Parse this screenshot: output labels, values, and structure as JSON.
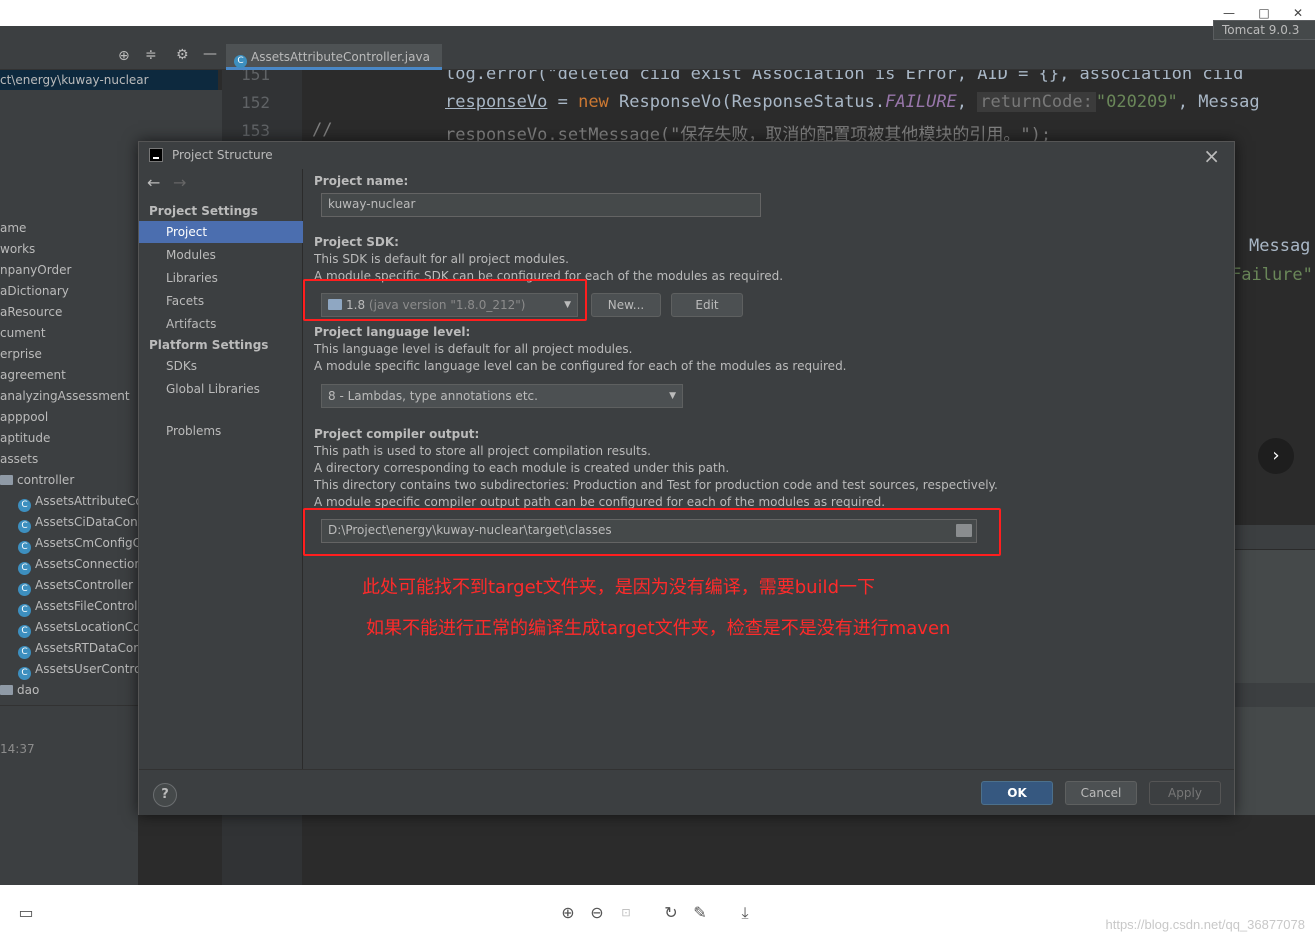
{
  "ide": {
    "path_fragment": "ct\\energy\\kuway-nuclear",
    "editor_tab": "AssetsAttributeController.java",
    "run_config": "Tomcat 9.0.3",
    "tree_items": [
      "ame",
      "works",
      "npanyOrder",
      "aDictionary",
      "aResource",
      "cument",
      "erprise",
      "agreement",
      "analyzingAssessment",
      "apppool",
      "aptitude",
      "assets"
    ],
    "tree_controller": "controller",
    "tree_classes": [
      "AssetsAttributeCo",
      "AssetsCiDataCont",
      "AssetsCmConfigC",
      "AssetsConnection",
      "AssetsController",
      "AssetsFileControll",
      "AssetsLocationCo",
      "AssetsRTDataCon",
      "AssetsUserContro"
    ],
    "tree_dao": "dao",
    "bottom_time": "14:37",
    "code": {
      "line_151": "151",
      "line_152": "152",
      "line_153": "153",
      "l151_text": "log.error(\"deleted ciid exist Association is Error, AID = {}, association ciid",
      "l152_a": "responseVo",
      "l152_b": " = ",
      "l152_new": "new",
      "l152_c": " ResponseVo(ResponseStatus.",
      "l152_const": "FAILURE",
      "l152_d": ", ",
      "l152_hint": "returnCode:",
      "l152_str": "\"020209\"",
      "l152_e": ", Messag",
      "l153_cmt": "//",
      "l153_text": "responseVo.setMessage(\"保存失败，取消的配置项被其他模块的引用。\");",
      "r_messag": "Messag",
      "r_failure": "Failure\""
    }
  },
  "dialog": {
    "title": "Project Structure",
    "close_icon": "close-icon",
    "nav": {
      "section_project_settings": "Project Settings",
      "section_platform_settings": "Platform Settings",
      "project": "Project",
      "modules": "Modules",
      "libraries": "Libraries",
      "facets": "Facets",
      "artifacts": "Artifacts",
      "sdks": "SDKs",
      "global_libraries": "Global Libraries",
      "problems": "Problems"
    },
    "project_name_label": "Project name:",
    "project_name_value": "kuway-nuclear",
    "sdk_label": "Project SDK:",
    "sdk_desc1": "This SDK is default for all project modules.",
    "sdk_desc2": "A module specific SDK can be configured for each of the modules as required.",
    "sdk_selected": "1.8",
    "sdk_detail": "(java version \"1.8.0_212\")",
    "new_button": "New...",
    "edit_button": "Edit",
    "lang_label": "Project language level:",
    "lang_desc1": "This language level is default for all project modules.",
    "lang_desc2": "A module specific language level can be configured for each of the modules as required.",
    "lang_selected": "8 - Lambdas, type annotations etc.",
    "compiler_label": "Project compiler output:",
    "compiler_desc1": "This path is used to store all project compilation results.",
    "compiler_desc2": "A directory corresponding to each module is created under this path.",
    "compiler_desc3": "This directory contains two subdirectories: Production and Test for production code and test sources, respectively.",
    "compiler_desc4": "A module specific compiler output path can be configured for each of the modules as required.",
    "compiler_path": "D:\\Project\\energy\\kuway-nuclear\\target\\classes",
    "annotation1": "此处可能找不到target文件夹，是因为没有编译，需要build一下",
    "annotation2": "如果不能进行正常的编译生成target文件夹，检查是不是没有进行maven",
    "ok_button": "OK",
    "cancel_button": "Cancel",
    "apply_button": "Apply",
    "help_button": "?"
  },
  "viewer": {
    "watermark": "https://blog.csdn.net/qq_36877078"
  },
  "colors": {
    "annotation_red": "#ff1e1e",
    "selection_blue": "#4b6eaf",
    "primary_button": "#365880"
  }
}
